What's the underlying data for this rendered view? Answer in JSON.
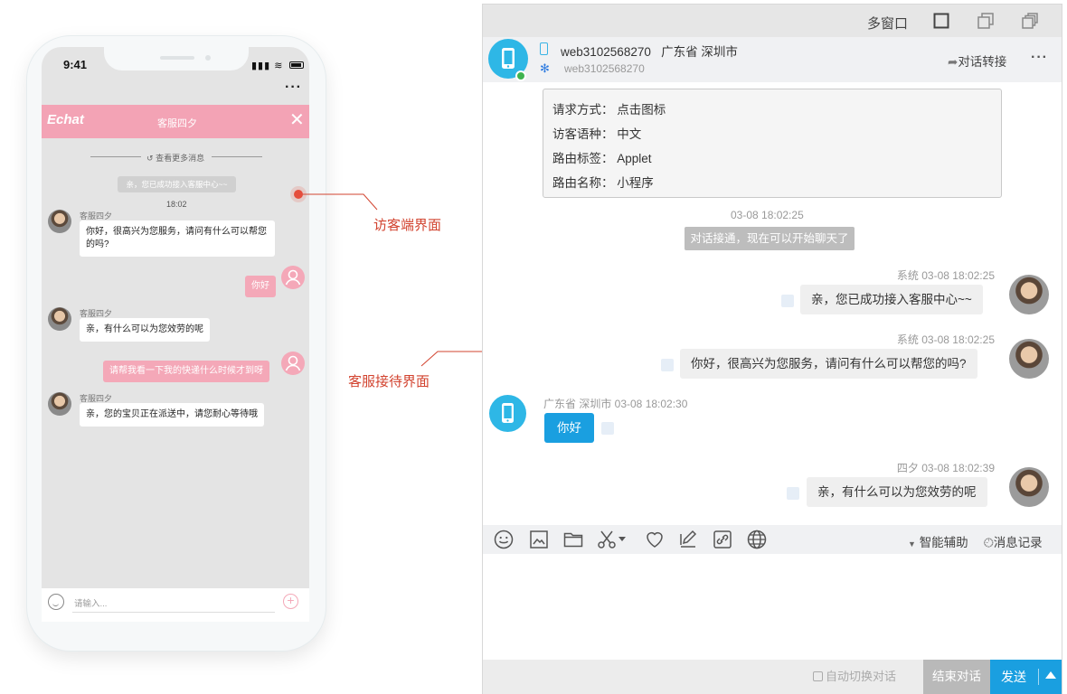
{
  "phone": {
    "status_time": "9:41",
    "more_icon": "more-dots-icon",
    "header_logo": "Echat",
    "header_title": "客服四夕",
    "close_icon": "close-icon",
    "load_more": "查看更多消息",
    "system_notice": "亲，您已成功接入客服中心~~",
    "timestamp": "18:02",
    "messages": [
      {
        "from": "agent",
        "name": "客服四夕",
        "text": "你好，很高兴为您服务，请问有什么可以帮您的吗?"
      },
      {
        "from": "user",
        "text": "你好"
      },
      {
        "from": "agent",
        "name": "客服四夕",
        "text": "亲，有什么可以为您效劳的呢"
      },
      {
        "from": "user",
        "text": "请帮我看一下我的快递什么时候才到呀"
      },
      {
        "from": "agent",
        "name": "客服四夕",
        "text": "亲，您的宝贝正在派送中，请您耐心等待哦"
      }
    ],
    "input_placeholder": "请输入..."
  },
  "annotations": {
    "visitor_label": "访客端界面",
    "agent_label": "客服接待界面",
    "color": "#d2432f"
  },
  "console": {
    "multi_window": "多窗口",
    "visitor": {
      "id": "web3102568270",
      "location": "广东省 深圳市",
      "sub_id": "web3102568270"
    },
    "transfer": "对话转接",
    "info": {
      "method": "请求方式：  点击图标",
      "language": "访客语种：  中文",
      "route_tag": "路由标签：  Applet",
      "route_name": "路由名称：  小程序"
    },
    "connected_time": "03-08 18:02:25",
    "connected_notice": "对话接通，现在可以开始聊天了",
    "messages": [
      {
        "meta": "系统  03-08 18:02:25",
        "text": "亲，您已成功接入客服中心~~"
      },
      {
        "meta": "系统  03-08 18:02:25",
        "text": "你好，很高兴为您服务，请问有什么可以帮您的吗?"
      },
      {
        "meta": "广东省 深圳市  03-08 18:02:30",
        "text": "你好"
      },
      {
        "meta": "四夕  03-08 18:02:39",
        "text": "亲，有什么可以为您效劳的呢"
      }
    ],
    "toolbar": {
      "assist": "智能辅助",
      "history": "消息记录"
    },
    "auto_switch": "自动切换对话",
    "end_chat": "结束对话",
    "send": "发送",
    "accent": "#1a9fe0",
    "phone_accent": "#f3a3b5"
  }
}
